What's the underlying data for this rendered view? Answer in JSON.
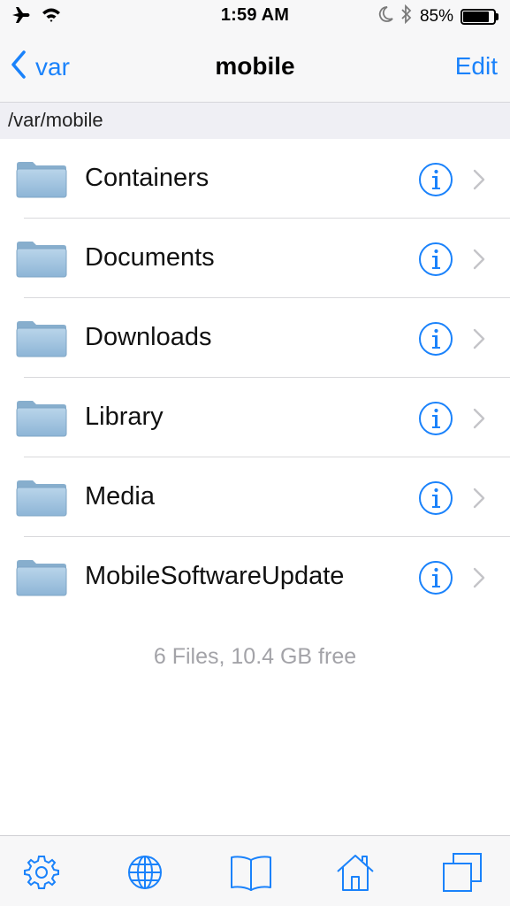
{
  "status_bar": {
    "time": "1:59 AM",
    "battery_text": "85%",
    "battery_level": 0.85,
    "icons": [
      "airplane-icon",
      "wifi-icon",
      "moon-icon",
      "bluetooth-icon",
      "battery-icon"
    ]
  },
  "nav": {
    "back_label": "var",
    "title": "mobile",
    "edit_label": "Edit"
  },
  "path": "/var/mobile",
  "items": [
    {
      "name": "Containers",
      "icon": "folder-icon"
    },
    {
      "name": "Documents",
      "icon": "folder-icon"
    },
    {
      "name": "Downloads",
      "icon": "folder-icon"
    },
    {
      "name": "Library",
      "icon": "folder-icon"
    },
    {
      "name": "Media",
      "icon": "folder-icon"
    },
    {
      "name": "MobileSoftwareUpdate",
      "icon": "folder-icon"
    }
  ],
  "summary": "6 Files, 10.4 GB free",
  "tabbar": {
    "tabs": [
      {
        "name": "settings",
        "icon": "gear-icon"
      },
      {
        "name": "web",
        "icon": "globe-icon"
      },
      {
        "name": "bookmarks",
        "icon": "book-icon"
      },
      {
        "name": "home",
        "icon": "home-icon"
      },
      {
        "name": "windows",
        "icon": "windows-icon"
      }
    ]
  },
  "colors": {
    "accent": "#1a82fb",
    "bar_background": "#f7f7f8",
    "path_background": "#efeff4",
    "muted_text": "#a3a3a8",
    "folder_blue": "#9fc3de"
  }
}
